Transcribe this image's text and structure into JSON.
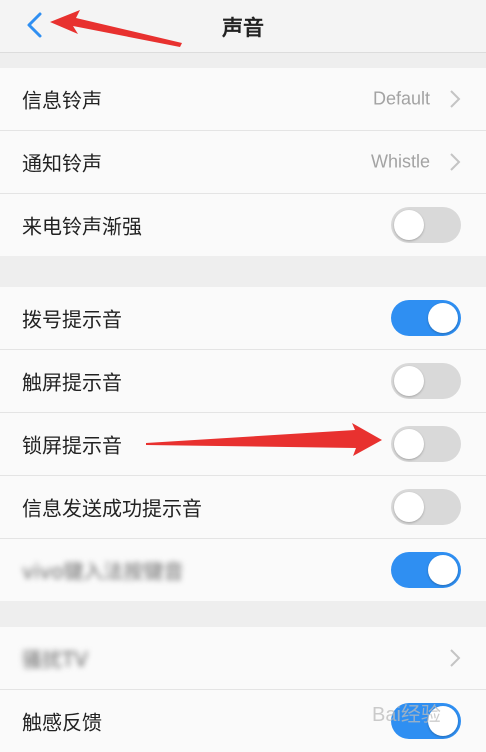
{
  "header": {
    "title": "声音"
  },
  "groups": {
    "g1": [
      {
        "label": "信息铃声",
        "value": "Default"
      },
      {
        "label": "通知铃声",
        "value": "Whistle"
      },
      {
        "label": "来电铃声渐强",
        "toggle": false
      }
    ],
    "g2": [
      {
        "label": "拨号提示音",
        "toggle": true
      },
      {
        "label": "触屏提示音",
        "toggle": false
      },
      {
        "label": "锁屏提示音",
        "toggle": false
      },
      {
        "label": "信息发送成功提示音",
        "toggle": false
      },
      {
        "label": "vivo键入法按键音",
        "toggle": true
      }
    ],
    "g3": [
      {
        "label": "骚扰TV"
      },
      {
        "label": "触感反馈",
        "toggle": true
      }
    ]
  },
  "watermark": "Bai经验",
  "colors": {
    "accent": "#2f8ff2",
    "arrow": "#e8312f",
    "toggle_off": "#d9d9d9"
  }
}
